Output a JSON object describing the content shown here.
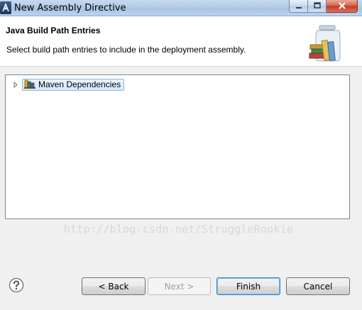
{
  "window": {
    "title": "New Assembly Directive",
    "controls": {
      "minimize_icon": "minimize-icon",
      "maximize_icon": "maximize-icon",
      "close_icon": "close-icon"
    }
  },
  "header": {
    "title": "Java Build Path Entries",
    "description": "Select build path entries to include in the deployment assembly.",
    "image_icon": "library-jar-icon"
  },
  "tree": {
    "items": [
      {
        "label": "Maven Dependencies",
        "icon": "library-icon",
        "expanded": false,
        "selected": true
      }
    ]
  },
  "watermark": "http://blog.csdn.net/StruggleRookie",
  "footer": {
    "help_icon": "help-icon",
    "back_label": "< Back",
    "next_label": "Next >",
    "finish_label": "Finish",
    "cancel_label": "Cancel"
  },
  "colors": {
    "selection_border": "#8fb5e3",
    "titlebar": "#b3cbe6",
    "dialog_background": "#f0f0f0"
  }
}
